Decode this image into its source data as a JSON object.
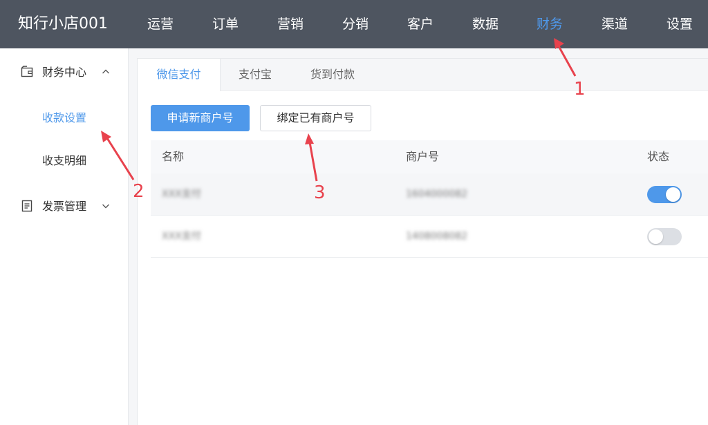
{
  "header": {
    "brand": "知行小店001",
    "nav": [
      {
        "label": "运营"
      },
      {
        "label": "订单"
      },
      {
        "label": "营销"
      },
      {
        "label": "分销"
      },
      {
        "label": "客户"
      },
      {
        "label": "数据"
      },
      {
        "label": "财务",
        "active": true
      },
      {
        "label": "渠道"
      },
      {
        "label": "设置"
      }
    ]
  },
  "sidebar": {
    "groups": [
      {
        "label": "财务中心",
        "icon": "wallet-icon",
        "expanded": true,
        "items": [
          {
            "label": "收款设置",
            "active": true
          },
          {
            "label": "收支明细"
          }
        ]
      },
      {
        "label": "发票管理",
        "icon": "invoice-icon",
        "expanded": false
      }
    ]
  },
  "tabs": [
    {
      "label": "微信支付",
      "active": true
    },
    {
      "label": "支付宝"
    },
    {
      "label": "货到付款"
    }
  ],
  "actions": {
    "apply_label": "申请新商户号",
    "bind_label": "绑定已有商户号"
  },
  "table": {
    "columns": [
      "名称",
      "商户号",
      "状态"
    ],
    "rows": [
      {
        "name": "XXX支付",
        "merchant_id": "1604000082",
        "enabled": true
      },
      {
        "name": "XXX支付",
        "merchant_id": "1408008082",
        "enabled": false
      }
    ]
  },
  "annotations": {
    "labels": [
      "1",
      "2",
      "3"
    ],
    "color": "#e8424d"
  },
  "colors": {
    "accent": "#4e98ea",
    "topbar": "#4e5560",
    "annotation": "#e8424d"
  }
}
